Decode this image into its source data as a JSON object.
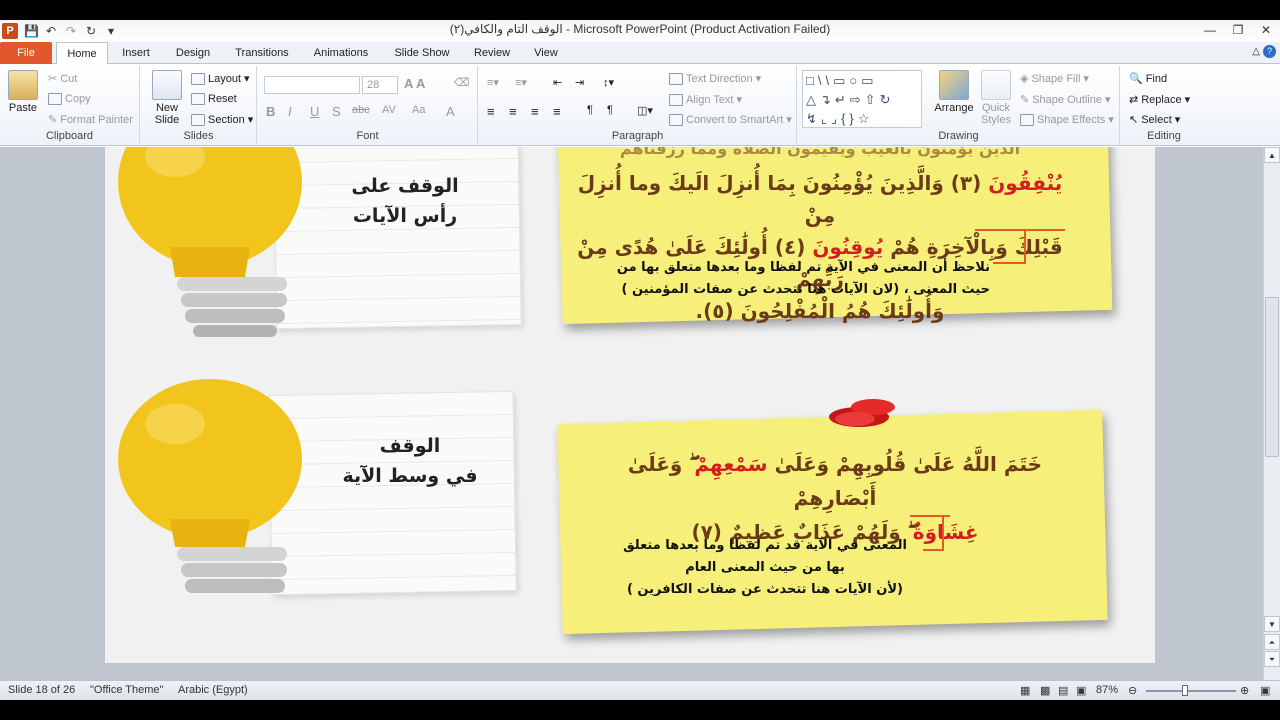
{
  "window": {
    "title": "(٢)الوقف التام والكافي  -  Microsoft PowerPoint (Product Activation Failed)"
  },
  "tabs": [
    "File",
    "Home",
    "Insert",
    "Design",
    "Transitions",
    "Animations",
    "Slide Show",
    "Review",
    "View"
  ],
  "ribbon": {
    "clipboard": {
      "label": "Clipboard",
      "paste": "Paste",
      "cut": "Cut",
      "copy": "Copy",
      "format_painter": "Format Painter"
    },
    "slides": {
      "label": "Slides",
      "new_slide": "New Slide",
      "layout": "Layout",
      "reset": "Reset",
      "section": "Section"
    },
    "font": {
      "label": "Font",
      "size": "28"
    },
    "paragraph": {
      "label": "Paragraph",
      "text_direction": "Text Direction",
      "align_text": "Align Text",
      "convert_smartart": "Convert to SmartArt"
    },
    "drawing": {
      "label": "Drawing",
      "arrange": "Arrange",
      "quick_styles": "Quick Styles",
      "shape_fill": "Shape Fill",
      "shape_outline": "Shape Outline",
      "shape_effects": "Shape Effects"
    },
    "editing": {
      "label": "Editing",
      "find": "Find",
      "replace": "Replace",
      "select": "Select"
    }
  },
  "slide": {
    "card1": {
      "line1": "الوقف على",
      "line2": "رأس الآيات"
    },
    "card2": {
      "line1": "الوقف",
      "line2": "في وسط الآية"
    },
    "note1": {
      "verse_line0": "الذين يؤمنون بالغيب ويقيمون الصلاة ومما رزقناهم",
      "verse_line1_a": "يُنْفِقُونَ",
      "verse_line1_b": "(٣) وَالَّذِينَ يُؤْمِنُونَ بِمَا أُنزِلَ الَيكَ وما أُنزِلَ مِنْ",
      "verse_line2_a": "قَبْلِكَ وَبِالْآخِرَةِ هُمْ",
      "verse_line2_b": "يُوقِنُونَ",
      "verse_line2_c": "(٤) أُولَٰئِكَ عَلَىٰ هُدًى مِنْ رَبِّهِمْ",
      "verse_line3": "وَأُولَٰئِكَ هُمُ الْمُفْلِحُونَ (٥).",
      "comment_line1": "نلاحظ أن المعنى في الآية تم لفظا وما بعدها متعلق بها من",
      "comment_line2": "حيث المعنى ، (لان الآيات هنا تتحدث عن صفات المؤمنين )"
    },
    "note2": {
      "verse_line1_a": "خَتَمَ اللَّهُ عَلَىٰ قُلُوبِهِمْ وَعَلَىٰ",
      "verse_line1_b": "سَمْعِهِمْ",
      "verse_line1_c": "ۖ وَعَلَىٰ أَبْصَارِهِمْ",
      "verse_line2_a": "غِشَاوَةٌ",
      "verse_line2_b": "ۖ وَلَهُمْ عَذَابٌ عَظِيمٌ (٧)",
      "comment_line1": "المعنى في الآية قد تم لفظا وما بعدها متعلق",
      "comment_line2": "بها من حيث المعنى العام",
      "comment_line3": "(لأن الآيات هنا  تتحدث  عن صفات الكافرين )"
    }
  },
  "status": {
    "slide": "Slide 18 of 26",
    "theme": "\"Office Theme\"",
    "language": "Arabic (Egypt)",
    "zoom": "87%"
  },
  "colors": {
    "accent_red": "#d31e1e",
    "note_yellow": "#f6f07a",
    "bulb_yellow": "#f2c51d",
    "file_tab": "#e2572b"
  }
}
